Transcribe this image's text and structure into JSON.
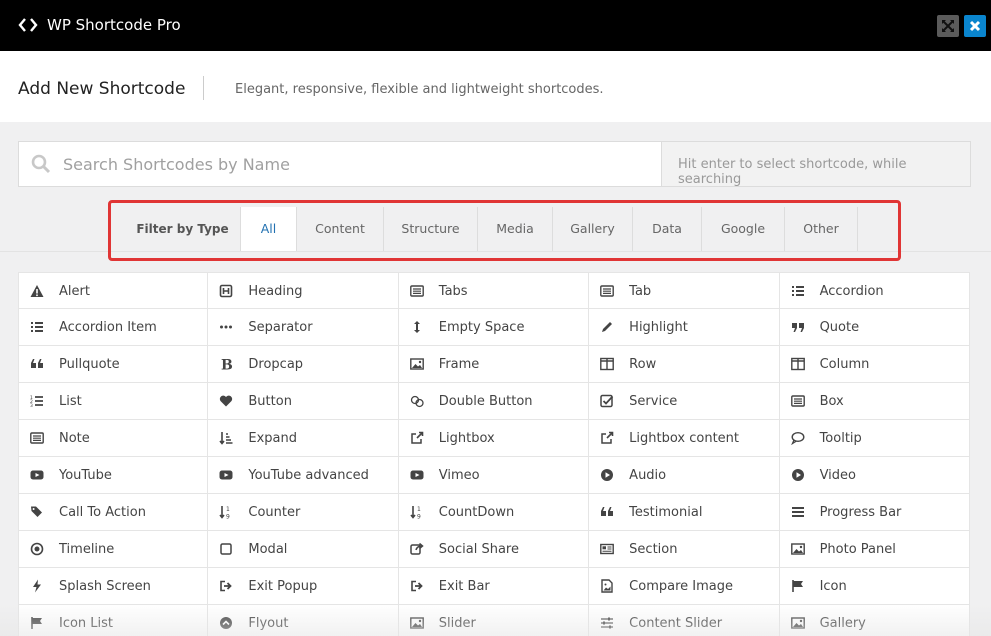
{
  "window": {
    "title": "WP Shortcode Pro",
    "title_icon": "code-icon",
    "buttons": [
      {
        "name": "maximize",
        "icon": "expand-icon",
        "color": "#5b5b5b"
      },
      {
        "name": "close",
        "icon": "close-icon",
        "color": "#0a85ce"
      }
    ]
  },
  "header": {
    "title": "Add New Shortcode",
    "subtitle": "Elegant, responsive, flexible and lightweight shortcodes."
  },
  "search": {
    "placeholder": "Search Shortcodes by Name",
    "value": "",
    "hint": "Hit enter to select shortcode, while searching"
  },
  "filter": {
    "label": "Filter by Type",
    "tabs": [
      "All",
      "Content",
      "Structure",
      "Media",
      "Gallery",
      "Data",
      "Google",
      "Other"
    ],
    "active": "All",
    "highlight_color": "#e03535"
  },
  "shortcodes": [
    {
      "label": "Alert",
      "icon": "warning-icon"
    },
    {
      "label": "Heading",
      "icon": "heading-icon"
    },
    {
      "label": "Tabs",
      "icon": "list-alt-icon"
    },
    {
      "label": "Tab",
      "icon": "list-alt-icon"
    },
    {
      "label": "Accordion",
      "icon": "list-icon"
    },
    {
      "label": "Accordion Item",
      "icon": "list-icon"
    },
    {
      "label": "Separator",
      "icon": "ellipsis-icon"
    },
    {
      "label": "Empty Space",
      "icon": "arrows-v-icon"
    },
    {
      "label": "Highlight",
      "icon": "pencil-icon"
    },
    {
      "label": "Quote",
      "icon": "quote-right-icon"
    },
    {
      "label": "Pullquote",
      "icon": "quote-left-icon"
    },
    {
      "label": "Dropcap",
      "icon": "bold-icon"
    },
    {
      "label": "Frame",
      "icon": "image-icon"
    },
    {
      "label": "Row",
      "icon": "columns-icon"
    },
    {
      "label": "Column",
      "icon": "columns-icon"
    },
    {
      "label": "List",
      "icon": "list-ol-icon"
    },
    {
      "label": "Button",
      "icon": "heart-icon"
    },
    {
      "label": "Double Button",
      "icon": "hand-pointer-icon"
    },
    {
      "label": "Service",
      "icon": "check-square-icon"
    },
    {
      "label": "Box",
      "icon": "list-alt-icon"
    },
    {
      "label": "Note",
      "icon": "list-alt-icon"
    },
    {
      "label": "Expand",
      "icon": "sort-amount-icon"
    },
    {
      "label": "Lightbox",
      "icon": "external-link-icon"
    },
    {
      "label": "Lightbox content",
      "icon": "external-link-icon"
    },
    {
      "label": "Tooltip",
      "icon": "comment-icon"
    },
    {
      "label": "YouTube",
      "icon": "youtube-icon"
    },
    {
      "label": "YouTube advanced",
      "icon": "youtube-icon"
    },
    {
      "label": "Vimeo",
      "icon": "youtube-icon"
    },
    {
      "label": "Audio",
      "icon": "play-circle-icon"
    },
    {
      "label": "Video",
      "icon": "play-circle-icon"
    },
    {
      "label": "Call To Action",
      "icon": "tags-icon"
    },
    {
      "label": "Counter",
      "icon": "sort-numeric-icon"
    },
    {
      "label": "CountDown",
      "icon": "sort-numeric-icon"
    },
    {
      "label": "Testimonial",
      "icon": "quote-left-icon"
    },
    {
      "label": "Progress Bar",
      "icon": "bars-icon"
    },
    {
      "label": "Timeline",
      "icon": "dot-circle-icon"
    },
    {
      "label": "Modal",
      "icon": "square-icon"
    },
    {
      "label": "Social Share",
      "icon": "share-icon"
    },
    {
      "label": "Section",
      "icon": "newspaper-icon"
    },
    {
      "label": "Photo Panel",
      "icon": "image-icon"
    },
    {
      "label": "Splash Screen",
      "icon": "bolt-icon"
    },
    {
      "label": "Exit Popup",
      "icon": "sign-out-icon"
    },
    {
      "label": "Exit Bar",
      "icon": "sign-out-icon"
    },
    {
      "label": "Compare Image",
      "icon": "file-image-icon"
    },
    {
      "label": "Icon",
      "icon": "flag-icon"
    },
    {
      "label": "Icon List",
      "icon": "flag-icon"
    },
    {
      "label": "Flyout",
      "icon": "chevron-circle-icon"
    },
    {
      "label": "Slider",
      "icon": "image-icon"
    },
    {
      "label": "Content Slider",
      "icon": "sliders-icon"
    },
    {
      "label": "Gallery",
      "icon": "image-icon"
    }
  ]
}
